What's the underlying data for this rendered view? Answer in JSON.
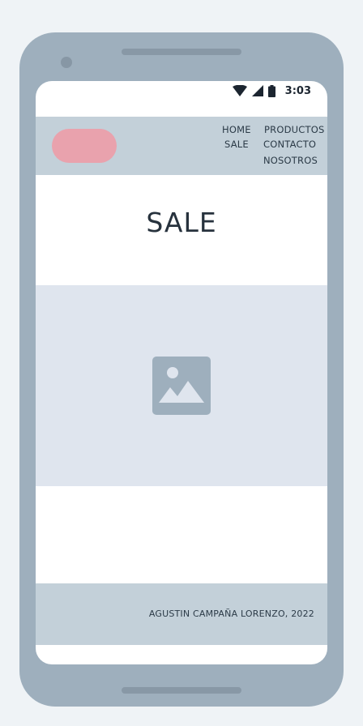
{
  "status_bar": {
    "time": "3:03",
    "icons": [
      "wifi-icon",
      "cellular-signal-icon",
      "battery-icon"
    ]
  },
  "nav": {
    "logo": "logo-placeholder",
    "links": {
      "home": "HOME",
      "productos": "PRODUCTOS",
      "sale": "SALE",
      "contacto": "CONTACTO",
      "nosotros": "NOSOTROS"
    }
  },
  "hero": {
    "title": "SALE"
  },
  "image_placeholder": {
    "icon": "image-icon"
  },
  "footer": {
    "text": "AGUSTIN CAMPAÑA LORENZO, 2022"
  },
  "colors": {
    "page_background": "#eff3f6",
    "device_frame": "#9eafbd",
    "navbar": "#c3d0d9",
    "logo_accent": "#e9a2ad",
    "image_block": "#dfe5ee",
    "text_dark": "#27323d"
  }
}
